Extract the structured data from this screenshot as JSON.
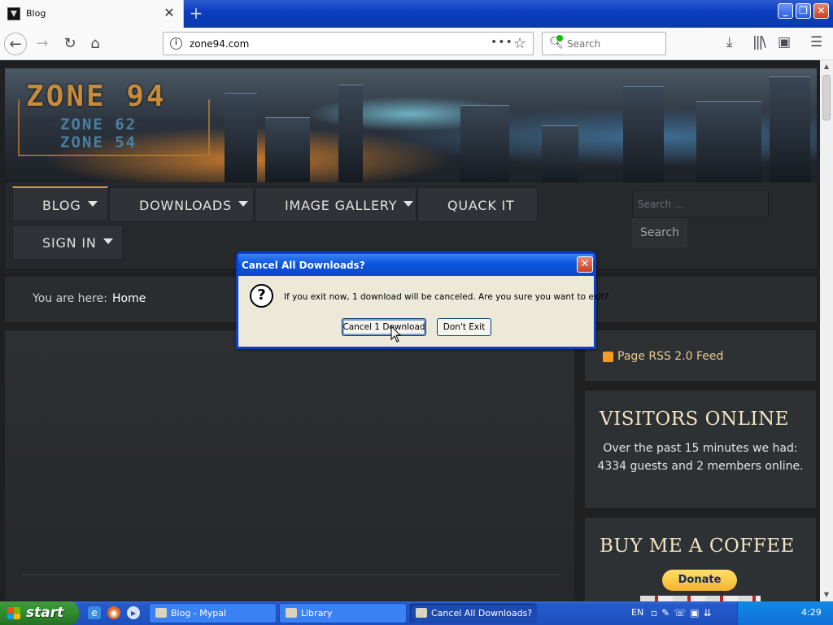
{
  "browser": {
    "tab_title": "Blog",
    "url": "zone94.com",
    "search_placeholder": "Search",
    "new_tab_symbol": "+",
    "url_actions": "•••"
  },
  "site": {
    "logo_main": "ZONE 94",
    "logo_sub1": "ZONE 62",
    "logo_sub2": "ZONE 54",
    "nav": [
      {
        "label": "BLOG",
        "has_dropdown": true,
        "active": true
      },
      {
        "label": "DOWNLOADS",
        "has_dropdown": true
      },
      {
        "label": "IMAGE GALLERY",
        "has_dropdown": true
      },
      {
        "label": "QUACK IT",
        "has_dropdown": false
      },
      {
        "label": "SIGN IN",
        "has_dropdown": true
      }
    ],
    "search_placeholder": "Search ...",
    "search_button": "Search",
    "breadcrumb_label": "You are here:",
    "breadcrumb_home": "Home",
    "rss": "Page RSS 2.0 Feed",
    "visitors_title": "VISITORS ONLINE",
    "visitors_text": "Over the past 15 minutes we had: 4334 guests and 2 members online.",
    "coffee_title": "BUY ME A COFFEE",
    "donate": "Donate"
  },
  "dialog": {
    "title": "Cancel All Downloads?",
    "message": "If you exit now, 1 download will be canceled. Are you sure you want to exit?",
    "confirm_button": "Cancel 1 Download",
    "deny_button": "Don't Exit",
    "icon": "question-icon"
  },
  "taskbar": {
    "start": "start",
    "tasks": [
      "Blog - Mypal",
      "Library",
      "Cancel All Downloads?"
    ],
    "language": "EN",
    "clock": "4:29"
  }
}
